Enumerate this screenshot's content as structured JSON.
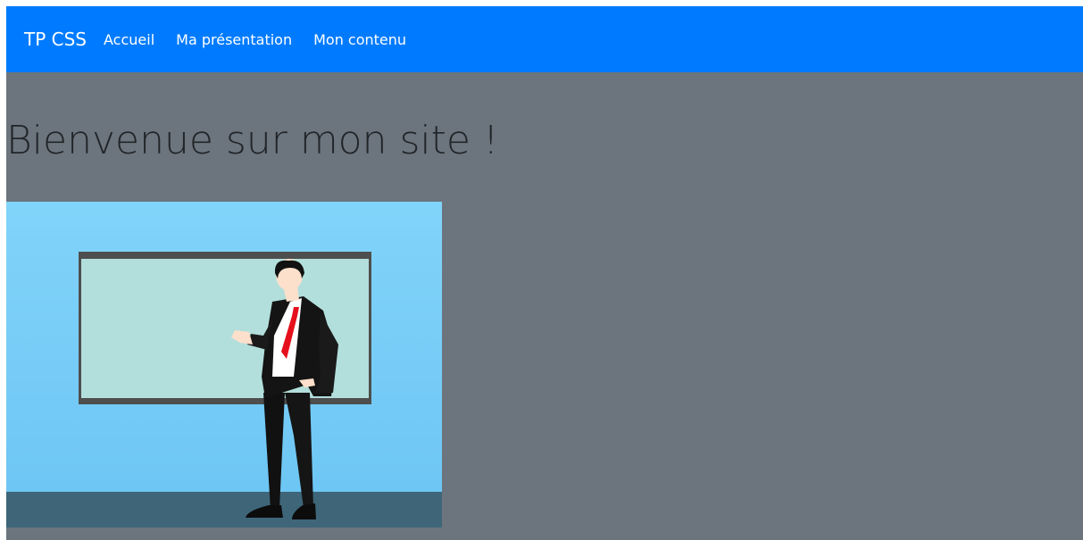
{
  "navbar": {
    "brand": "TP CSS",
    "links": [
      {
        "label": "Accueil"
      },
      {
        "label": "Ma présentation"
      },
      {
        "label": "Mon contenu"
      }
    ]
  },
  "main": {
    "title": "Bienvenue sur mon site !",
    "illustration": {
      "subject": "presenter-at-whiteboard-illustration"
    }
  },
  "colors": {
    "navbar_bg": "#007bff",
    "page_bg": "#6c757d",
    "title_text": "#212529",
    "sky": "#81d4fa",
    "floor": "#3e6678",
    "board": "#b2dfdb",
    "board_frame": "#4e4e4e",
    "tie": "#e5101c",
    "suit": "#111111"
  }
}
